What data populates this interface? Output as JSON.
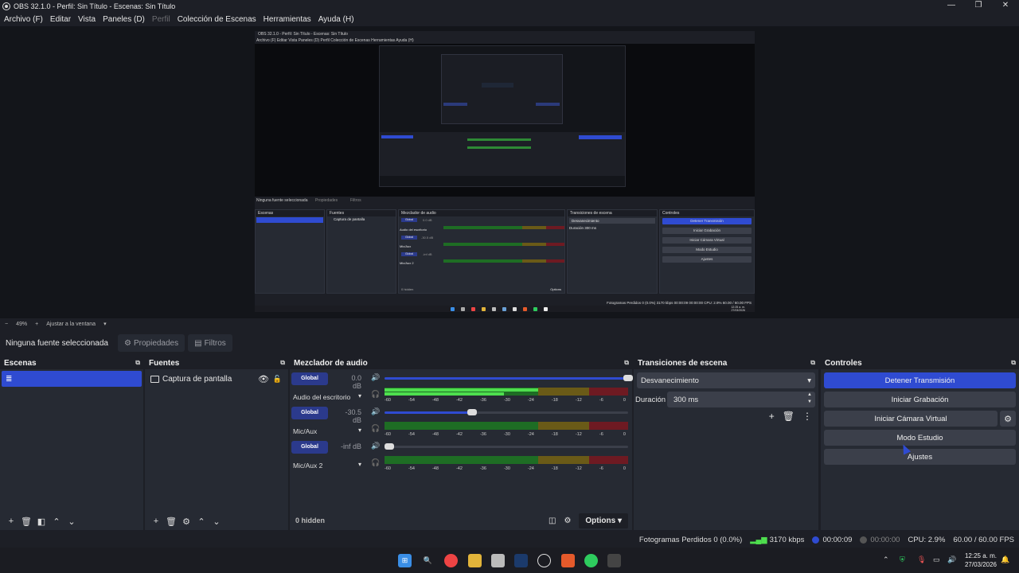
{
  "window": {
    "title": "OBS 32.1.0 - Perfil: Sin Título - Escenas: Sin Título",
    "controls": [
      "—",
      "❐",
      "✕"
    ]
  },
  "menu": [
    {
      "label": "Archivo (F)",
      "enabled": true
    },
    {
      "label": "Editar",
      "enabled": true
    },
    {
      "label": "Vista",
      "enabled": true
    },
    {
      "label": "Paneles (D)",
      "enabled": true
    },
    {
      "label": "Perfil",
      "enabled": false
    },
    {
      "label": "Colección de Escenas",
      "enabled": true
    },
    {
      "label": "Herramientas",
      "enabled": true
    },
    {
      "label": "Ayuda (H)",
      "enabled": true
    }
  ],
  "preview_nested": {
    "title": "OBS 32.1.0 - Perfil: Sin Título - Escenas: Sin Título",
    "scenes_header": "Escenas",
    "sources_header": "Fuentes",
    "source_item": "Captura de pantalla",
    "mixer_header": "Mezclador de audio",
    "transitions_header": "Transiciones de escena",
    "controls_header": "Controles",
    "no_source": "Ninguna fuente seleccionada",
    "properties": "Propiedades",
    "filters": "Filtros",
    "transition": "Desvanecimiento",
    "duration_label": "Duración",
    "duration": "300 ms",
    "ctrl_buttons": [
      "Detener Transmisión",
      "Iniciar Grabación",
      "Iniciar Cámara Virtual",
      "Modo Estudio",
      "Ajustes"
    ],
    "mixer": [
      {
        "name": "Audio del escritorio",
        "db": "0.0 dB"
      },
      {
        "name": "Mic/Aux",
        "db": "-30.5 dB"
      },
      {
        "name": "Mic/Aux 2",
        "db": "-inf dB"
      }
    ],
    "global": "Global",
    "hidden": "0 hidden",
    "options": "Options",
    "status": "Fotogramas Perdidos 0 (0.0%)   3170 kbps   00:00:09   00:00:00   CPU: 2.9%   60.00 / 60.00 FPS",
    "clock_time": "12:25 a. m.",
    "clock_date": "27/03/2026"
  },
  "zoom": {
    "minus": "−",
    "level": "49%",
    "plus": "+",
    "fit": "Ajustar a la ventana",
    "dropdown": "▾"
  },
  "source_bar": {
    "no_source": "Ninguna fuente seleccionada",
    "properties": "Propiedades",
    "filters": "Filtros"
  },
  "scenes": {
    "title": "Escenas",
    "items": [
      "≣"
    ],
    "footer": [
      "+",
      "🗑",
      "◧",
      "⌃",
      "⌄"
    ]
  },
  "sources": {
    "title": "Fuentes",
    "items": [
      {
        "label": "Captura de pantalla",
        "visible": true,
        "locked": false
      }
    ],
    "footer": [
      "+",
      "🗑",
      "⚙",
      "⌃",
      "⌄"
    ]
  },
  "mixer": {
    "title": "Mezclador de audio",
    "global_label": "Global",
    "channels": [
      {
        "name": "Audio del escritorio",
        "db": "0.0 dB",
        "volume": 1.0,
        "level": 0.63
      },
      {
        "name": "Mic/Aux",
        "db": "-30.5 dB",
        "volume": 0.36,
        "level": 0.0
      },
      {
        "name": "Mic/Aux 2",
        "db": "-inf dB",
        "volume": 0.0,
        "level": 0.0
      }
    ],
    "ticks": [
      "-60",
      "-54",
      "-48",
      "-42",
      "-36",
      "-30",
      "-24",
      "-18",
      "-12",
      "-6",
      "0"
    ],
    "hidden_label": "0 hidden",
    "options_label": "Options"
  },
  "transitions": {
    "title": "Transiciones de escena",
    "selected": "Desvanecimiento",
    "duration_label": "Duración",
    "duration_value": "300 ms"
  },
  "controls": {
    "title": "Controles",
    "stop_stream": "Detener Transmisión",
    "start_record": "Iniciar Grabación",
    "start_vcam": "Iniciar Cámara Virtual",
    "studio_mode": "Modo Estudio",
    "settings": "Ajustes"
  },
  "status": {
    "dropped": "Fotogramas Perdidos 0 (0.0%)",
    "bitrate": "3170 kbps",
    "stream_time": "00:00:09",
    "record_time": "00:00:00",
    "cpu": "CPU: 2.9%",
    "fps": "60.00 / 60.00 FPS"
  },
  "taskbar": {
    "time": "12:25 a. m.",
    "date": "27/03/2026"
  },
  "colors": {
    "accent": "#2f4bd1",
    "panel": "#262a33",
    "background": "#1d1f26",
    "meter_green": "#4ede4e",
    "meter_yellow": "#6a5a17",
    "meter_red": "#6e1a22"
  }
}
